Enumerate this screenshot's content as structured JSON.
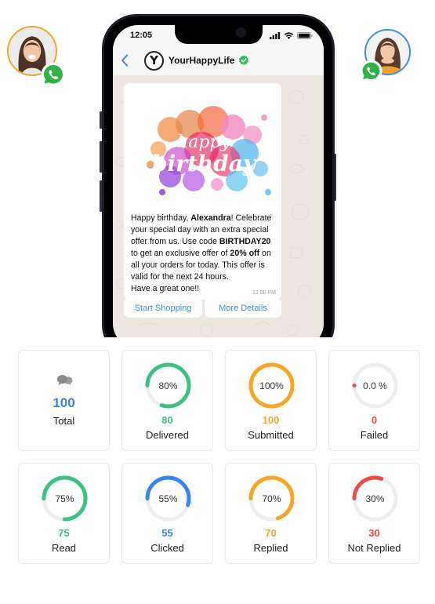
{
  "contacts": {
    "left": {
      "name": "avatar-left",
      "ring_color": "#f5a623"
    },
    "right": {
      "name": "avatar-right",
      "ring_color": "#3b8df0"
    },
    "badge_icon": "whatsapp-icon"
  },
  "phone": {
    "status_time": "12:05",
    "status_icons": [
      "signal-icon",
      "wifi-icon",
      "battery-icon"
    ],
    "header": {
      "back_icon": "chevron-left-icon",
      "logo_letter": "Y",
      "business_name": "YourHappyLife",
      "verified_icon": "verified-check-icon"
    },
    "message": {
      "image_caption_line1": "happy",
      "image_caption_line2": "birthday",
      "text_parts": {
        "p1": "Happy birthday, ",
        "name": "Alexandra",
        "p2": "! Celebrate your special day with an extra special offer from us. Use code ",
        "code": "BIRTHDAY20",
        "p3": " to get an exclusive offer of ",
        "discount": "20% off",
        "p4": " on all your orders for today. This offer is valid for the next 24 hours.",
        "p5": "Have a great one!!"
      },
      "time": "12:00 PM"
    },
    "buttons": [
      {
        "label": "Start Shopping"
      },
      {
        "label": "More Details"
      }
    ]
  },
  "stats": {
    "total": {
      "icon": "chat-bubbles-icon",
      "value": "100",
      "label": "Total",
      "color": "#3b82e6"
    },
    "cards": [
      {
        "key": "delivered",
        "percent": 80,
        "percent_label": "80%",
        "value": "80",
        "label": "Delivered",
        "color": "#3cc384"
      },
      {
        "key": "submitted",
        "percent": 100,
        "percent_label": "100%",
        "value": "100",
        "label": "Submitted",
        "color": "#f8a623"
      },
      {
        "key": "failed",
        "percent": 0,
        "percent_label": "0.0 %",
        "value": "0",
        "label": "Failed",
        "color": "#ee4b4b"
      },
      {
        "key": "read",
        "percent": 75,
        "percent_label": "75%",
        "value": "75",
        "label": "Read",
        "color": "#3cc384"
      },
      {
        "key": "clicked",
        "percent": 55,
        "percent_label": "55%",
        "value": "55",
        "label": "Clicked",
        "color": "#3a86f0"
      },
      {
        "key": "replied",
        "percent": 70,
        "percent_label": "70%",
        "value": "70",
        "label": "Replied",
        "color": "#f8a623"
      },
      {
        "key": "not_replied",
        "percent": 30,
        "percent_label": "30%",
        "value": "30",
        "label": "Not Replied",
        "color": "#ee4b4b"
      }
    ]
  }
}
